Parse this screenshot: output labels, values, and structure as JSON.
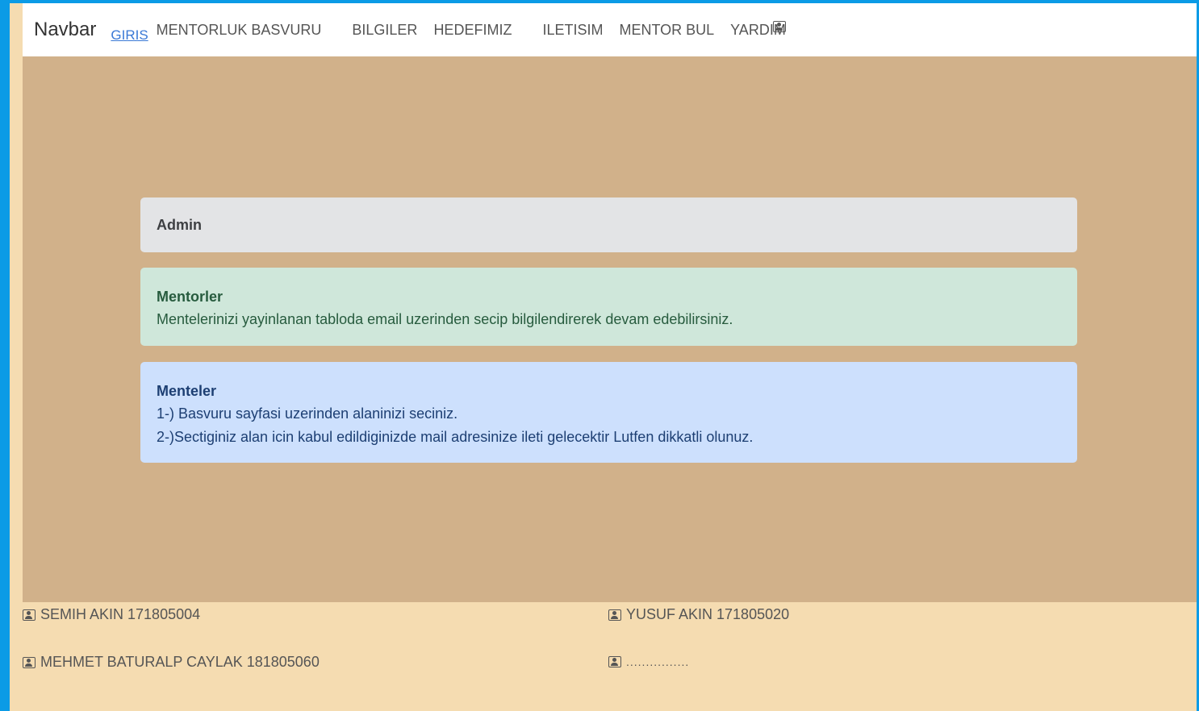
{
  "navbar": {
    "brand": "Navbar",
    "links": [
      "GIRIS",
      "MENTORLUK BASVURU",
      "BILGILER",
      "HEDEFIMIZ",
      "ILETISIM",
      "MENTOR BUL",
      "YARDIM"
    ],
    "icon": "user-card-icon"
  },
  "cards": {
    "admin": {
      "title": "Admin"
    },
    "mentorler": {
      "title": "Mentorler",
      "text": "Mentelerinizi yayinlanan tabloda email uzerinden secip bilgilendirerek devam edebilirsiniz."
    },
    "menteler": {
      "title": "Menteler",
      "line1": "1-) Basvuru sayfasi uzerinden alaninizi seciniz.",
      "line2": "2-)Sectiginiz alan icin kabul edildiginizde mail adresinize ileti gelecektir Lutfen dikkatli olunuz."
    }
  },
  "footer": {
    "people": [
      "SEMIH AKIN 171805004",
      "YUSUF AKIN 171805020",
      "MEHMET BATURALP CAYLAK 181805060",
      "................"
    ]
  },
  "colors": {
    "outer": "#0b9be6",
    "page": "#f5dcb1",
    "main": "#d1b18a",
    "admin": "#e3e4e6",
    "mentor": "#cfe7da",
    "mentee": "#cde0fd"
  }
}
